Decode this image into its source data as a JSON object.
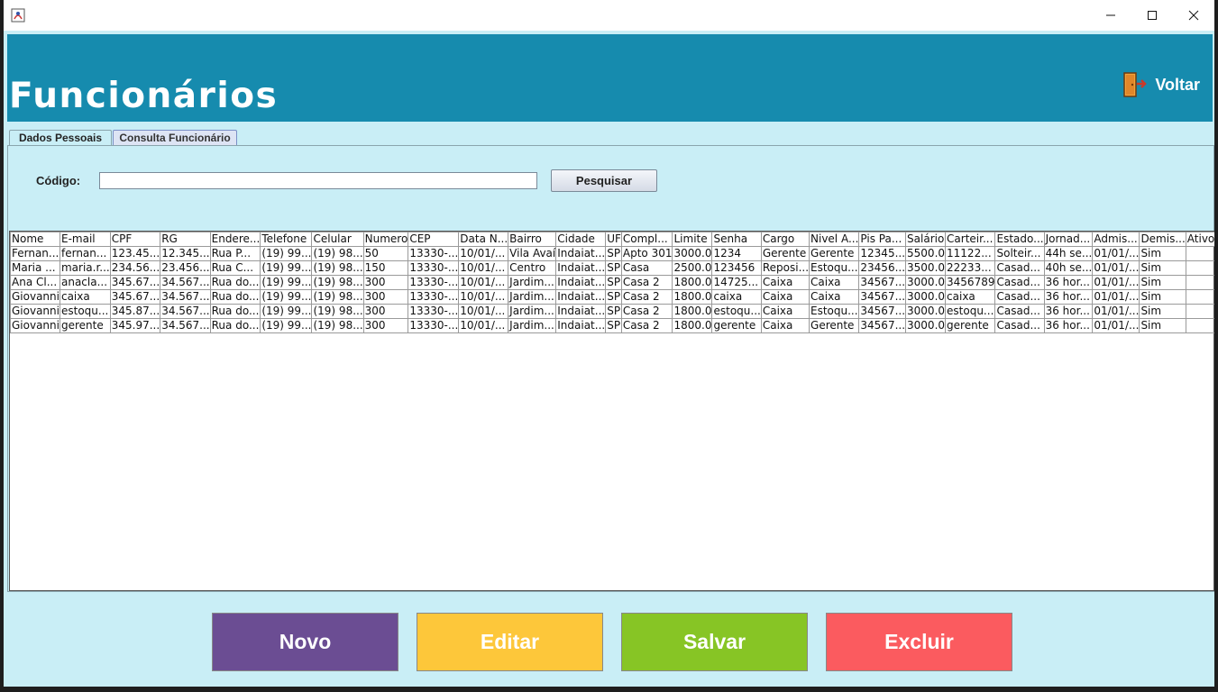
{
  "window": {
    "buttons": [
      "minimize",
      "maximize",
      "close"
    ]
  },
  "header": {
    "title": "Funcionários",
    "back_label": "Voltar"
  },
  "tabs": [
    {
      "label": "Dados Pessoais",
      "active": false
    },
    {
      "label": "Consulta Funcionário",
      "active": true
    }
  ],
  "search": {
    "label": "Código:",
    "value": "",
    "button_label": "Pesquisar"
  },
  "table": {
    "columns": [
      "Nome",
      "E-mail",
      "CPF",
      "RG",
      "Endere...",
      "Telefone",
      "Celular",
      "Numero",
      "CEP",
      "Data N...",
      "Bairro",
      "Cidade",
      "UF",
      "Compl...",
      "Limite",
      "Senha",
      "Cargo",
      "Nivel A...",
      "Pis Pa...",
      "Salário",
      "Carteir...",
      "Estado...",
      "Jornad...",
      "Admis...",
      "Demis...",
      "Ativo"
    ],
    "rows": [
      [
        "Fernan...",
        "fernan...",
        "123.45...",
        "12.345...",
        "Rua P...",
        "(19) 99...",
        "(19) 98...",
        "50",
        "13330-...",
        "10/01/...",
        "Vila Avaí",
        "Indaiat...",
        "SP",
        "Apto 301",
        "3000.0",
        "1234",
        "Gerente",
        "Gerente",
        "12345...",
        "5500.0",
        "11122...",
        "Solteir...",
        "44h se...",
        "01/01/...",
        "Sim",
        ""
      ],
      [
        "Maria ...",
        "maria.r...",
        "234.56...",
        "23.456...",
        "Rua C...",
        "(19) 99...",
        "(19) 98...",
        "150",
        "13330-...",
        "10/01/...",
        "Centro",
        "Indaiat...",
        "SP",
        "Casa",
        "2500.0",
        "123456",
        "Reposi...",
        "Estoqu...",
        "23456...",
        "3500.0",
        "22233...",
        "Casad...",
        "40h se...",
        "01/01/...",
        "Sim",
        ""
      ],
      [
        "Ana Cl...",
        "anacla...",
        "345.67...",
        "34.567...",
        "Rua do...",
        "(19) 99...",
        "(19) 98...",
        "300",
        "13330-...",
        "10/01/...",
        "Jardim...",
        "Indaiat...",
        "SP",
        "Casa 2",
        "1800.0",
        "14725...",
        "Caixa",
        "Caixa",
        "34567...",
        "3000.0",
        "3456789",
        "Casad...",
        "36 hor...",
        "01/01/...",
        "Sim",
        ""
      ],
      [
        "Giovanni",
        "caixa",
        "345.67...",
        "34.567...",
        "Rua do...",
        "(19) 99...",
        "(19) 98...",
        "300",
        "13330-...",
        "10/01/...",
        "Jardim...",
        "Indaiat...",
        "SP",
        "Casa 2",
        "1800.0",
        "caixa",
        "Caixa",
        "Caixa",
        "34567...",
        "3000.0",
        "caixa",
        "Casad...",
        "36 hor...",
        "01/01/...",
        "Sim",
        ""
      ],
      [
        "Giovanni",
        "estoqu...",
        "345.87...",
        "34.567...",
        "Rua do...",
        "(19) 99...",
        "(19) 98...",
        "300",
        "13330-...",
        "10/01/...",
        "Jardim...",
        "Indaiat...",
        "SP",
        "Casa 2",
        "1800.0",
        "estoqu...",
        "Caixa",
        "Estoqu...",
        "34567...",
        "3000.0",
        "estoqu...",
        "Casad...",
        "36 hor...",
        "01/01/...",
        "Sim",
        ""
      ],
      [
        "Giovanni",
        "gerente",
        "345.97...",
        "34.567...",
        "Rua do...",
        "(19) 99...",
        "(19) 98...",
        "300",
        "13330-...",
        "10/01/...",
        "Jardim...",
        "Indaiat...",
        "SP",
        "Casa 2",
        "1800.0",
        "gerente",
        "Caixa",
        "Gerente",
        "34567...",
        "3000.0",
        "gerente",
        "Casad...",
        "36 hor...",
        "01/01/...",
        "Sim",
        ""
      ]
    ]
  },
  "actions": {
    "novo": "Novo",
    "editar": "Editar",
    "salvar": "Salvar",
    "excluir": "Excluir"
  },
  "colors": {
    "header": "#168bae",
    "background": "#c9eef6",
    "novo": "#6b4d93",
    "editar": "#fdc73a",
    "salvar": "#87c525",
    "excluir": "#fb5b5f"
  },
  "icons": {
    "app": "java-app-icon",
    "back": "door-exit-icon"
  }
}
